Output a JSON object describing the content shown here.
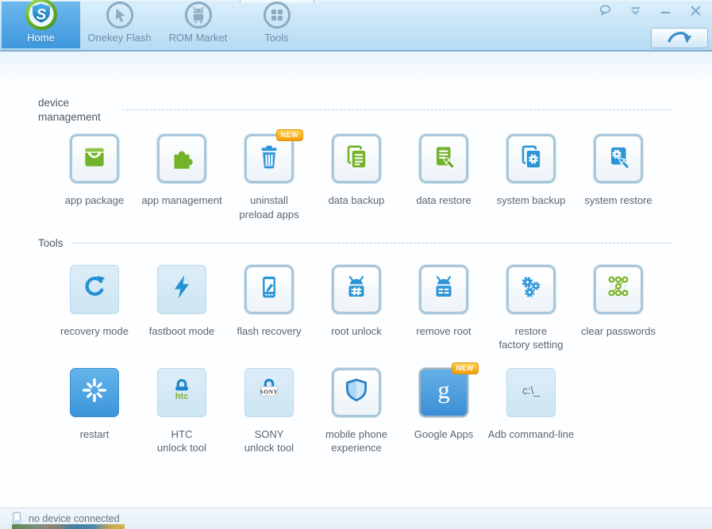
{
  "window": {
    "controls": [
      {
        "name": "feedback",
        "icon": "speech-bubble-icon"
      },
      {
        "name": "skin-menu",
        "icon": "chevron-line-icon"
      },
      {
        "name": "minimize",
        "icon": "minimize-icon"
      },
      {
        "name": "close",
        "icon": "close-icon"
      }
    ],
    "action_button": {
      "icon": "curved-arrow-icon"
    }
  },
  "nav": {
    "tabs": [
      {
        "id": "home",
        "label": "Home",
        "icon": "shuame-logo",
        "active": true
      },
      {
        "id": "onekey-flash",
        "label": "Onekey Flash",
        "icon": "onekey-cursor-icon",
        "active": false
      },
      {
        "id": "rom-market",
        "label": "ROM Market",
        "icon": "android-robot-icon",
        "active": false
      },
      {
        "id": "tools",
        "label": "Tools",
        "icon": "grid-icon",
        "active": false
      }
    ]
  },
  "sections": [
    {
      "id": "device-management",
      "title": "device management",
      "items": [
        {
          "label": "app package",
          "icon": "shopping-bag",
          "tile": "bordered"
        },
        {
          "label": "app management",
          "icon": "puzzle",
          "tile": "bordered"
        },
        {
          "label": "uninstall\npreload apps",
          "icon": "trash",
          "tile": "bordered",
          "badge": "NEW"
        },
        {
          "label": "data backup",
          "icon": "docs-green",
          "tile": "bordered"
        },
        {
          "label": "data restore",
          "icon": "doc-restore-green",
          "tile": "bordered"
        },
        {
          "label": "system backup",
          "icon": "docs-gear-blue",
          "tile": "bordered"
        },
        {
          "label": "system restore",
          "icon": "gear-restore-blue",
          "tile": "bordered"
        }
      ]
    },
    {
      "id": "tools",
      "title": "Tools",
      "items": [
        {
          "label": "recovery mode",
          "icon": "refresh-arrow",
          "tile": "flat"
        },
        {
          "label": "fastboot mode",
          "icon": "lightning-bolt",
          "tile": "flat"
        },
        {
          "label": "flash recovery",
          "icon": "phone-edit",
          "tile": "bordered"
        },
        {
          "label": "root unlock",
          "icon": "android-unlock",
          "tile": "bordered"
        },
        {
          "label": "remove root",
          "icon": "android-remove",
          "tile": "bordered"
        },
        {
          "label": "restore\nfactory setting",
          "icon": "gears",
          "tile": "bordered"
        },
        {
          "label": "clear passwords",
          "icon": "pattern-lock",
          "tile": "bordered"
        },
        {
          "label": "restart",
          "icon": "restart-spinner",
          "tile": "solid"
        },
        {
          "label": "HTC\nunlock tool",
          "icon": "htc-lock",
          "tile": "flat"
        },
        {
          "label": "SONY\nunlock tool",
          "icon": "sony-lock",
          "tile": "flat"
        },
        {
          "label": "mobile phone\nexperience",
          "icon": "shield",
          "tile": "bordered"
        },
        {
          "label": "Google Apps",
          "icon": "google-g",
          "tile": "google",
          "badge": "NEW"
        },
        {
          "label": "Adb command-line",
          "icon": "adb-prompt",
          "tile": "flat"
        }
      ]
    }
  ],
  "status_bar": {
    "icon": "phone-icon",
    "text": "no device connected"
  },
  "colors": {
    "active_tab_blue": "#3e97db",
    "icon_blue": "#2b95d8",
    "icon_green": "#72b32a",
    "badge_orange": "#f59d0c",
    "header_blue": "#b5dbf3"
  }
}
